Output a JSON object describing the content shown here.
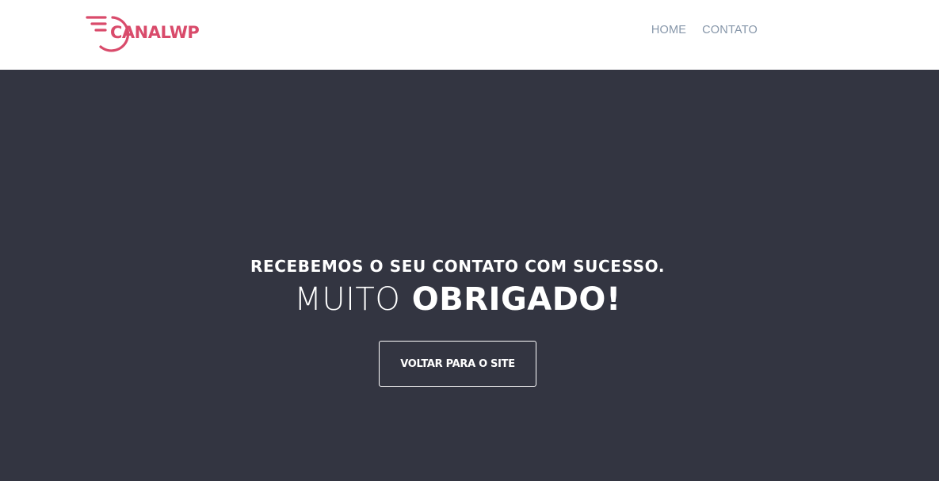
{
  "header": {
    "logo_text": "CANALWP",
    "nav": [
      {
        "label": "HOME"
      },
      {
        "label": "CONTATO"
      }
    ]
  },
  "hero": {
    "subtitle": "RECEBEMOS O SEU CONTATO COM SUCESSO.",
    "title_light": "MUITO",
    "title_bold": "OBRIGADO!",
    "button_label": "VOLTAR PARA O SITE"
  },
  "colors": {
    "brand": "#d94b6b",
    "nav_text": "#8696a9",
    "hero_bg": "#333541",
    "hero_text": "#ffffff"
  }
}
